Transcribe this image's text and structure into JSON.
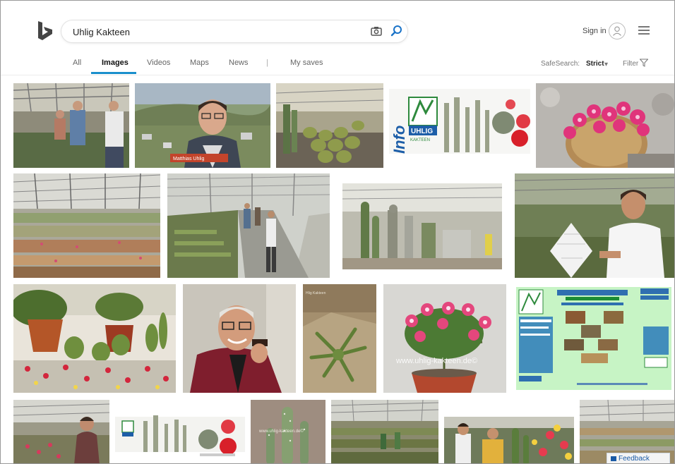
{
  "search": {
    "query": "Uhlig Kakteen"
  },
  "header": {
    "signin_label": "Sign in"
  },
  "nav": {
    "tabs": [
      "All",
      "Images",
      "Videos",
      "Maps",
      "News"
    ],
    "separator": "|",
    "my_saves": "My saves",
    "safesearch_label": "SafeSearch:",
    "safesearch_value": "Strict",
    "filter_label": "Filter"
  },
  "tiles": {
    "t2_caption": "Matthias Uhlig",
    "t4_info": "Info",
    "t4_brand": "UHLIG",
    "t4_brand_sub": "KAKTEEN",
    "t14_watermark": "www.uhlig-kakteen.de©",
    "t13_title": "Hlig Kakteen",
    "t18_watermark": "www.uhlig-kakteen.de©"
  },
  "feedback": {
    "label": "Feedback"
  },
  "colors": {
    "accent": "#1a8fcc",
    "link": "#1a5aa6"
  }
}
